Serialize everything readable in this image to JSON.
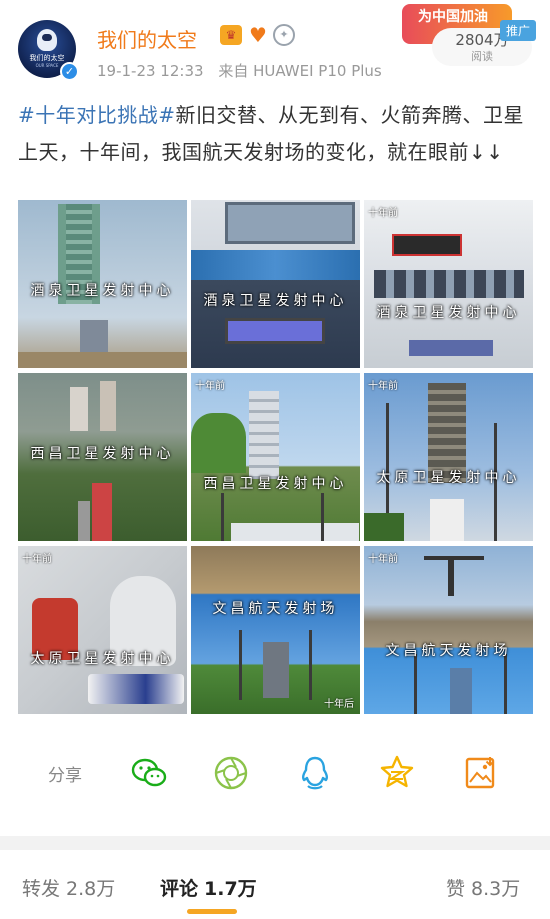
{
  "header": {
    "username": "我们的太空",
    "avatar_text": "我们的太空",
    "avatar_sub": "OUR SPACE",
    "timestamp": "19-1-23 12:33",
    "source": "来自 HUAWEI P10 Plus",
    "badges": [
      "crown-badge-icon",
      "heart-badge-icon",
      "medal-badge-icon"
    ],
    "promo_text": "为中国加油",
    "promo_tag": "推广",
    "read_count": "2804万",
    "read_label": "阅读"
  },
  "post": {
    "hashtag": "#十年对比挑战#",
    "body": "新旧交替、从无到有、火箭奔腾、卫星上天，十年间，我国航天发射场的变化，就在眼前↓↓"
  },
  "images": [
    {
      "caption": "酒泉卫星发射中心",
      "mark": ""
    },
    {
      "caption": "酒泉卫星发射中心",
      "mark": ""
    },
    {
      "caption": "酒泉卫星发射中心",
      "mark": "十年前"
    },
    {
      "caption": "西昌卫星发射中心",
      "mark": ""
    },
    {
      "caption": "西昌卫星发射中心",
      "mark": "十年前"
    },
    {
      "caption": "太原卫星发射中心",
      "mark": "十年前"
    },
    {
      "caption": "太原卫星发射中心",
      "mark": "十年前"
    },
    {
      "caption": "文昌航天发射场",
      "mark": "十年后"
    },
    {
      "caption": "文昌航天发射场",
      "mark": "十年前"
    }
  ],
  "actions": {
    "share_label": "分享",
    "icons": [
      "wechat-icon",
      "moments-icon",
      "qq-icon",
      "qzone-icon",
      "save-image-icon"
    ],
    "colors": {
      "green": "#1aad19",
      "lime": "#8bc34a",
      "blue": "#2aa3e0",
      "yellow": "#f5b400",
      "orange": "#f08a1a"
    }
  },
  "tabs": [
    {
      "label": "转发",
      "count": "2.8万"
    },
    {
      "label": "评论",
      "count": "1.7万",
      "active": true
    },
    {
      "label": "赞",
      "count": "8.3万"
    }
  ],
  "colors": {
    "username": "#f07a1a",
    "hashtag": "#3b74b5",
    "tab_underline": "#f5a623"
  }
}
